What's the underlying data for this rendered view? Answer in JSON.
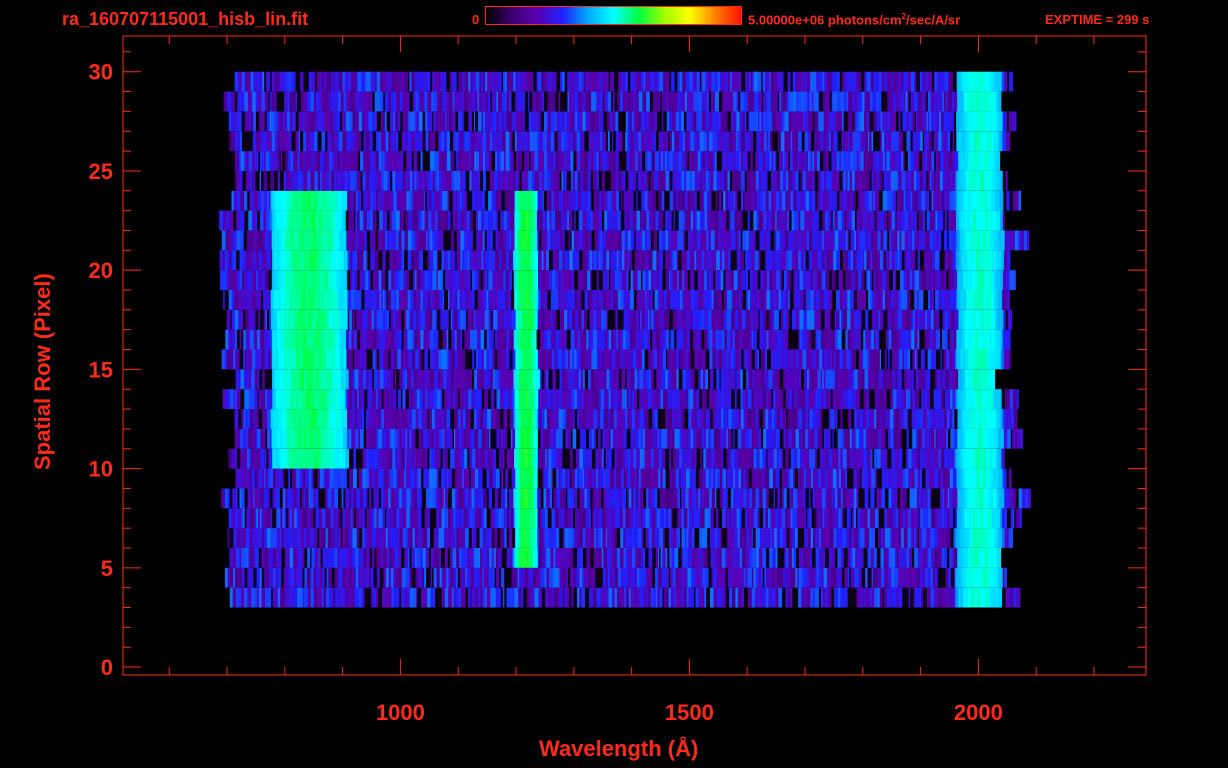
{
  "header": {
    "file_name": "ra_160707115001_hisb_lin.fit",
    "colorbar_min": "0",
    "colorbar_max_value": "5.00000e+06 photons/cm",
    "colorbar_max_exp": "2",
    "colorbar_max_units": "/sec/A/sr",
    "exptime": "EXPTIME = 299 s"
  },
  "colors": {
    "axis": "#ff2a1a",
    "background": "#000000",
    "colormap": [
      "#000000",
      "#3a0070",
      "#5a00b0",
      "#2020ff",
      "#00aaff",
      "#00ffff",
      "#00ff40",
      "#a0ff00",
      "#ffff00",
      "#ff8000",
      "#ff1000"
    ]
  },
  "chart_data": {
    "type": "heatmap",
    "title": "ra_160707115001_hisb_lin.fit",
    "xlabel": "Wavelength (Å)",
    "ylabel": "Spatial Row (Pixel)",
    "xlim": [
      520,
      2290
    ],
    "ylim": [
      -0.4,
      31.8
    ],
    "xticks": [
      1000,
      1500,
      2000
    ],
    "yticks": [
      0,
      5,
      10,
      15,
      20,
      25,
      30
    ],
    "color_range": [
      0,
      5000000
    ],
    "color_units": "photons/cm^2/sec/A/sr",
    "colormap": "rainbow",
    "grid": false,
    "data_extent": {
      "x": [
        700,
        2090
      ],
      "y": [
        3,
        30
      ]
    },
    "features": [
      {
        "center_x": 1215,
        "rows": [
          5,
          24
        ],
        "width_x": 40,
        "peak_intensity": 0.58
      },
      {
        "center_x": 840,
        "rows": [
          10,
          24
        ],
        "width_x": 130,
        "peak_intensity": 0.55
      },
      {
        "center_x": 2000,
        "rows": [
          3,
          30
        ],
        "width_x": 80,
        "peak_intensity": 0.5
      }
    ]
  }
}
